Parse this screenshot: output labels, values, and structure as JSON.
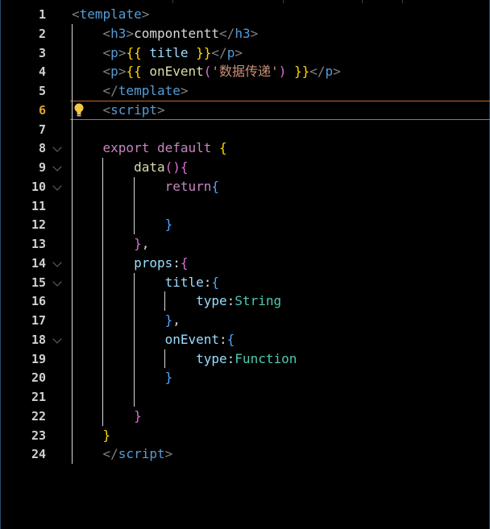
{
  "lines": [
    {
      "n": "1",
      "tokens": [
        [
          "tg",
          "<"
        ],
        [
          "tn",
          "template"
        ],
        [
          "tg",
          ">"
        ]
      ]
    },
    {
      "n": "2",
      "tokens": [
        [
          "tg",
          "    <"
        ],
        [
          "tn",
          "h3"
        ],
        [
          "tg",
          ">"
        ],
        [
          "mu",
          "compontentt"
        ],
        [
          "tg",
          "</"
        ],
        [
          "tn",
          "h3"
        ],
        [
          "tg",
          ">"
        ]
      ]
    },
    {
      "n": "3",
      "tokens": [
        [
          "tg",
          "    <"
        ],
        [
          "tn",
          "p"
        ],
        [
          "tg",
          ">"
        ],
        [
          "br1",
          "{{"
        ],
        [
          "pr",
          " title "
        ],
        [
          "br1",
          "}}"
        ],
        [
          "tg",
          "</"
        ],
        [
          "tn",
          "p"
        ],
        [
          "tg",
          ">"
        ]
      ]
    },
    {
      "n": "4",
      "tokens": [
        [
          "tg",
          "    <"
        ],
        [
          "tn",
          "p"
        ],
        [
          "tg",
          ">"
        ],
        [
          "br1",
          "{{"
        ],
        [
          "fn",
          " onEvent"
        ],
        [
          "br2",
          "("
        ],
        [
          "str",
          "'数据传递'"
        ],
        [
          "br2",
          ")"
        ],
        [
          "mu",
          " "
        ],
        [
          "br1",
          "}}"
        ],
        [
          "tg",
          "</"
        ],
        [
          "tn",
          "p"
        ],
        [
          "tg",
          ">"
        ]
      ]
    },
    {
      "n": "5",
      "tokens": [
        [
          "tg",
          "    </"
        ],
        [
          "tn",
          "template"
        ],
        [
          "tg",
          ">"
        ]
      ]
    },
    {
      "n": "6",
      "tokens": [
        [
          "tg",
          "    <"
        ],
        [
          "tn",
          "script"
        ],
        [
          "tg",
          ">"
        ]
      ]
    },
    {
      "n": "7",
      "tokens": []
    },
    {
      "n": "8",
      "tokens": [
        [
          "kw",
          "    export default "
        ],
        [
          "br1",
          "{"
        ]
      ]
    },
    {
      "n": "9",
      "tokens": [
        [
          "fn",
          "        data"
        ],
        [
          "br2",
          "()"
        ],
        [
          "br2",
          "{"
        ]
      ]
    },
    {
      "n": "10",
      "tokens": [
        [
          "kw",
          "            return"
        ],
        [
          "br3",
          "{"
        ]
      ]
    },
    {
      "n": "11",
      "tokens": []
    },
    {
      "n": "12",
      "tokens": [
        [
          "br3",
          "            }"
        ]
      ]
    },
    {
      "n": "13",
      "tokens": [
        [
          "br2",
          "        }"
        ],
        [
          "mu",
          ","
        ]
      ]
    },
    {
      "n": "14",
      "tokens": [
        [
          "pr",
          "        props"
        ],
        [
          "mu",
          ":"
        ],
        [
          "br2",
          "{"
        ]
      ]
    },
    {
      "n": "15",
      "tokens": [
        [
          "pr",
          "            title"
        ],
        [
          "mu",
          ":"
        ],
        [
          "br3",
          "{"
        ]
      ]
    },
    {
      "n": "16",
      "tokens": [
        [
          "pr",
          "                type"
        ],
        [
          "mu",
          ":"
        ],
        [
          "ty",
          "String"
        ]
      ]
    },
    {
      "n": "17",
      "tokens": [
        [
          "br3",
          "            }"
        ],
        [
          "mu",
          ","
        ]
      ]
    },
    {
      "n": "18",
      "tokens": [
        [
          "pr",
          "            onEvent"
        ],
        [
          "mu",
          ":"
        ],
        [
          "br3",
          "{"
        ]
      ]
    },
    {
      "n": "19",
      "tokens": [
        [
          "pr",
          "                type"
        ],
        [
          "mu",
          ":"
        ],
        [
          "ty",
          "Function"
        ]
      ]
    },
    {
      "n": "20",
      "tokens": [
        [
          "br3",
          "            }"
        ]
      ]
    },
    {
      "n": "21",
      "tokens": []
    },
    {
      "n": "22",
      "tokens": [
        [
          "br2",
          "        }"
        ]
      ]
    },
    {
      "n": "23",
      "tokens": [
        [
          "br1",
          "    }"
        ]
      ]
    },
    {
      "n": "24",
      "tokens": [
        [
          "tg",
          "    </"
        ],
        [
          "tn",
          "script"
        ],
        [
          "tg",
          ">"
        ]
      ]
    }
  ],
  "current_line": "6",
  "fold_lines": [
    "8",
    "9",
    "10",
    "14",
    "15",
    "18"
  ],
  "icons": {
    "lightbulb": "lightbulb-icon",
    "fold": "chevron-down-icon"
  },
  "colors": {
    "background": "#000000",
    "current_line_border": "#c46a2c",
    "lightbulb": "#f2c744"
  }
}
